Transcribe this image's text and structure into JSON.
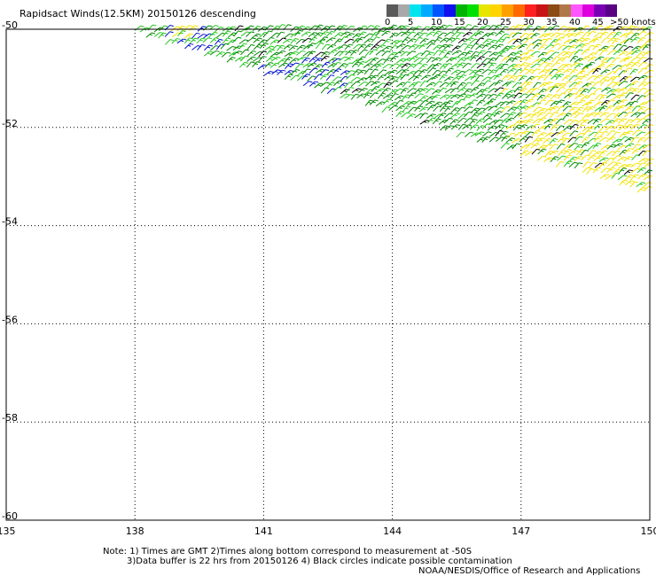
{
  "title": "Rapidsact Winds(12.5KM) 20150126 descending",
  "colorbar": {
    "unit_label": "knots",
    "bins": [
      {
        "label": "0",
        "color": "#5a5a5a"
      },
      {
        "label": "",
        "color": "#a8a8a8"
      },
      {
        "label": "5",
        "color": "#00e4f0"
      },
      {
        "label": "",
        "color": "#00aaff"
      },
      {
        "label": "10",
        "color": "#0055ff"
      },
      {
        "label": "",
        "color": "#1010ee"
      },
      {
        "label": "15",
        "color": "#00b400"
      },
      {
        "label": "",
        "color": "#00e000"
      },
      {
        "label": "20",
        "color": "#e6e600"
      },
      {
        "label": "",
        "color": "#ffd400"
      },
      {
        "label": "25",
        "color": "#ffa000"
      },
      {
        "label": "",
        "color": "#ff6a00"
      },
      {
        "label": "30",
        "color": "#ff2020"
      },
      {
        "label": "",
        "color": "#c81414"
      },
      {
        "label": "35",
        "color": "#8c4a14"
      },
      {
        "label": "",
        "color": "#b07848"
      },
      {
        "label": "40",
        "color": "#ff55ff"
      },
      {
        "label": "",
        "color": "#dd00dd"
      },
      {
        "label": "45",
        "color": "#7a00b4"
      },
      {
        "label": ">50",
        "color": "#5a0082"
      }
    ]
  },
  "map": {
    "lon_range": [
      135,
      150
    ],
    "lat_range": [
      -60,
      -50
    ],
    "lon_ticks": [
      "135",
      "138",
      "141",
      "144",
      "147",
      "150"
    ],
    "lat_ticks": [
      "-50",
      "-52",
      "-54",
      "-56",
      "-58",
      "-60"
    ]
  },
  "wind_colors": {
    "green_dark": "#008a00",
    "green_light": "#22c81e",
    "yellow": "#f2e400",
    "blue": "#0010c8",
    "black": "#000000"
  },
  "notes": {
    "line1": "Note: 1) Times are GMT 2)Times along bottom correspond to measurement at -50S",
    "line2": "3)Data buffer is 22 hrs from 20150126 4) Black circles indicate possible contamination",
    "credit": "NOAA/NESDIS/Office of Research and Applications"
  }
}
